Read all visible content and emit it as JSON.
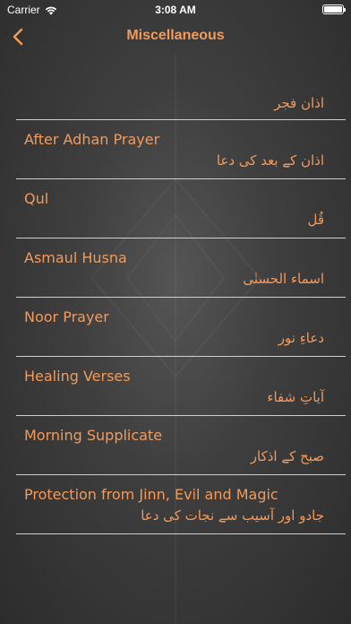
{
  "status_bar": {
    "carrier": "Carrier",
    "time": "3:08 AM"
  },
  "nav": {
    "title": "Miscellaneous",
    "back_icon": "chevron-left-icon"
  },
  "colors": {
    "accent": "#f39a5a",
    "separator": "#cfcfcf",
    "background": "#3f3f3f"
  },
  "items": [
    {
      "title": "",
      "urdu": "اذان فجر"
    },
    {
      "title": "After Adhan Prayer",
      "urdu": "اذان کے بعد کی دعا"
    },
    {
      "title": "Qul",
      "urdu": "قُل"
    },
    {
      "title": "Asmaul Husna",
      "urdu": "اسماء الحسنٰی"
    },
    {
      "title": "Noor Prayer",
      "urdu": "دعاءِ نور"
    },
    {
      "title": "Healing Verses",
      "urdu": "آیاتِ شفاء"
    },
    {
      "title": "Morning Supplicate",
      "urdu": "صبح کے اذکار"
    },
    {
      "title": "Protection from Jinn, Evil and Magic",
      "urdu": "جادو اور آسیب سے نجات کی دعا"
    }
  ]
}
